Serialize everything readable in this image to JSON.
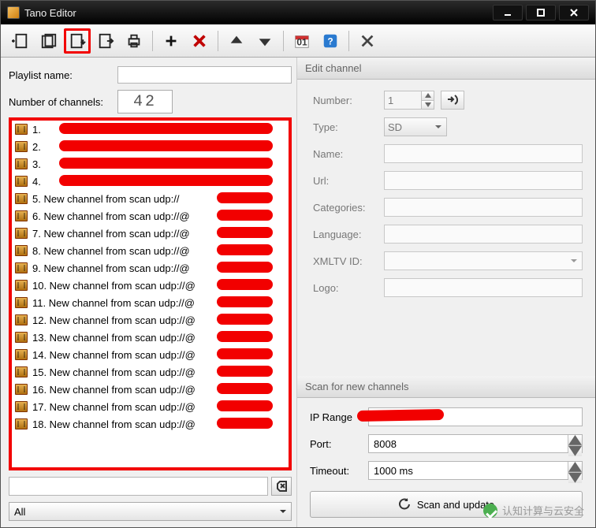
{
  "window": {
    "title": "Tano Editor"
  },
  "toolbar_icons": [
    "new",
    "open",
    "import",
    "export",
    "print",
    "plus",
    "delete",
    "up",
    "down",
    "calendar",
    "help",
    "close-panel"
  ],
  "left": {
    "playlist_label": "Playlist name:",
    "playlist_value": "",
    "numch_label": "Number of channels:",
    "numch_value": "42",
    "filter_value": "All",
    "search_value": ""
  },
  "channels": [
    {
      "n": 1,
      "label": "1."
    },
    {
      "n": 2,
      "label": "2."
    },
    {
      "n": 3,
      "label": "3."
    },
    {
      "n": 4,
      "label": "4."
    },
    {
      "n": 5,
      "label": "5. New channel from scan udp://"
    },
    {
      "n": 6,
      "label": "6. New channel from scan udp://@"
    },
    {
      "n": 7,
      "label": "7. New channel from scan udp://@"
    },
    {
      "n": 8,
      "label": "8. New channel from scan udp://@"
    },
    {
      "n": 9,
      "label": "9. New channel from scan udp://@"
    },
    {
      "n": 10,
      "label": "10. New channel from scan udp://@"
    },
    {
      "n": 11,
      "label": "11. New channel from scan udp://@"
    },
    {
      "n": 12,
      "label": "12. New channel from scan udp://@"
    },
    {
      "n": 13,
      "label": "13. New channel from scan udp://@"
    },
    {
      "n": 14,
      "label": "14. New channel from scan udp://@"
    },
    {
      "n": 15,
      "label": "15. New channel from scan udp://@"
    },
    {
      "n": 16,
      "label": "16. New channel from scan udp://@"
    },
    {
      "n": 17,
      "label": "17. New channel from scan udp://@"
    },
    {
      "n": 18,
      "label": "18. New channel from scan udp://@"
    }
  ],
  "edit": {
    "header": "Edit channel",
    "fields": {
      "number_label": "Number:",
      "number_value": "1",
      "type_label": "Type:",
      "type_value": "SD",
      "name_label": "Name:",
      "name_value": "",
      "url_label": "Url:",
      "url_value": "",
      "categories_label": "Categories:",
      "categories_value": "",
      "language_label": "Language:",
      "language_value": "",
      "xmltv_label": "XMLTV ID:",
      "xmltv_value": "",
      "logo_label": "Logo:",
      "logo_value": ""
    }
  },
  "scan": {
    "header": "Scan for new channels",
    "ip_label": "IP Range",
    "ip_value": "",
    "port_label": "Port:",
    "port_value": "8008",
    "timeout_label": "Timeout:",
    "timeout_value": "1000 ms",
    "button_label": "Scan and update"
  },
  "watermark": "认知计算与云安全"
}
